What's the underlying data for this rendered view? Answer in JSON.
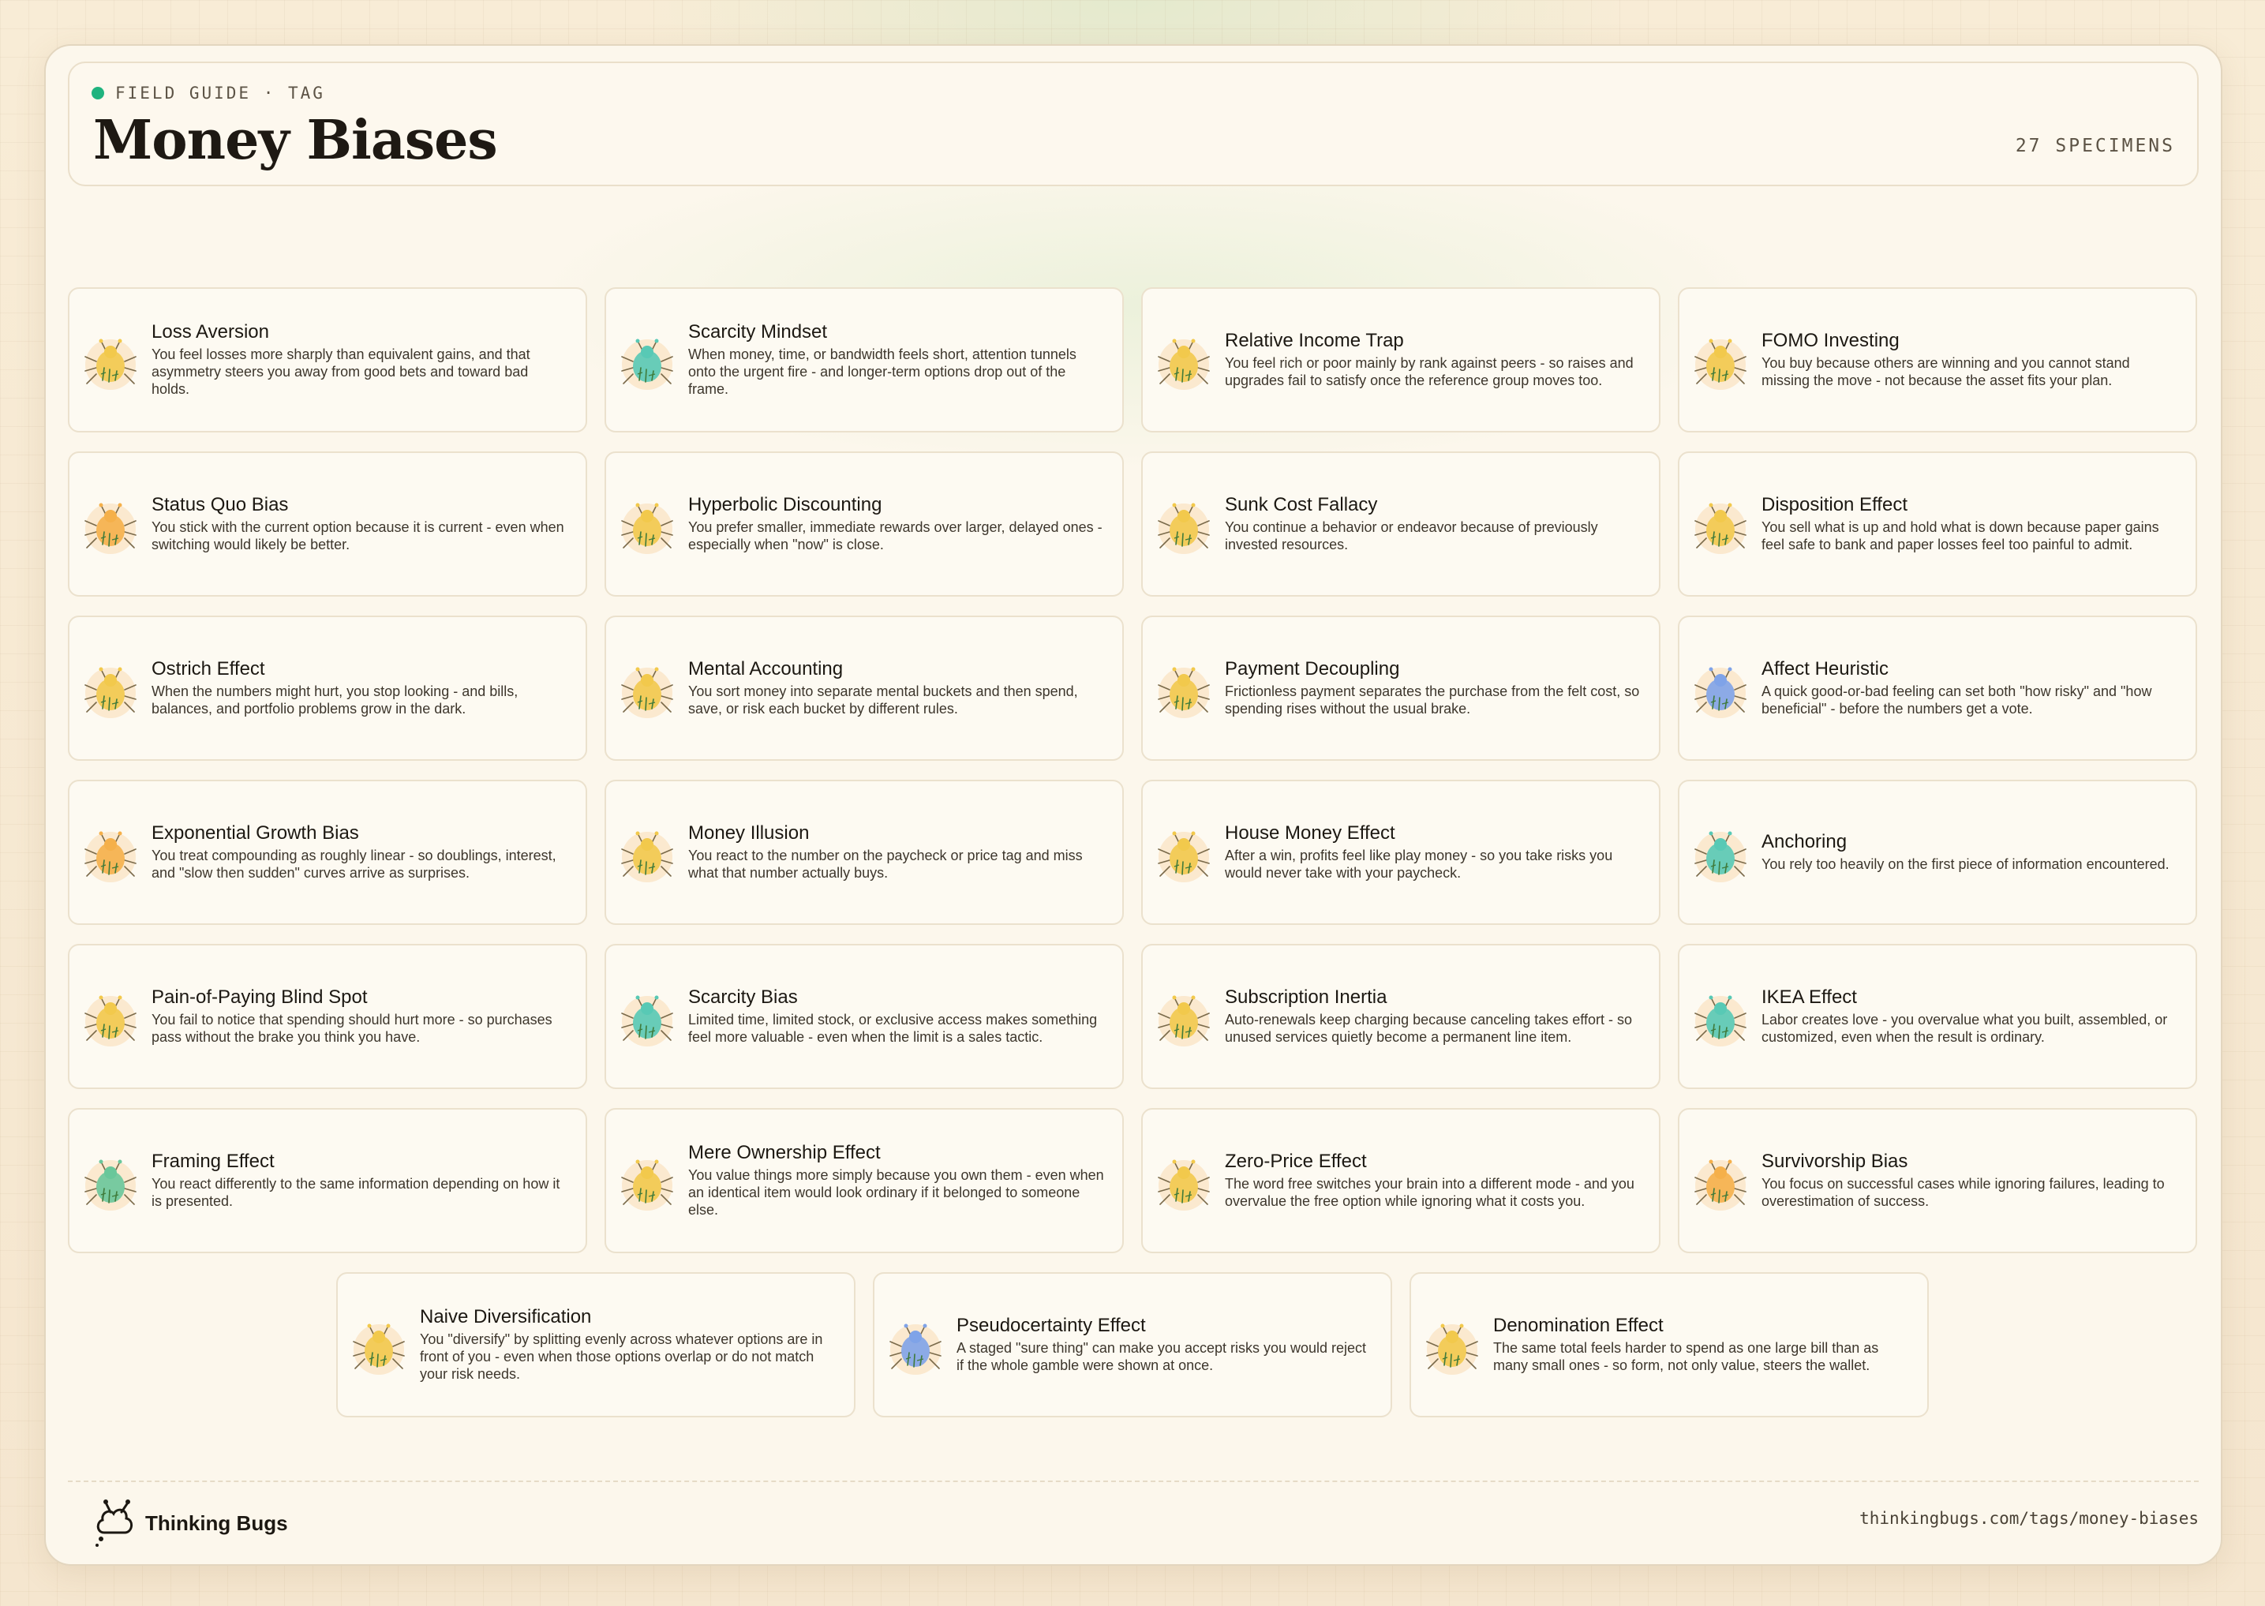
{
  "header": {
    "eyebrow": "FIELD GUIDE · TAG",
    "title": "Money Biases",
    "count": "27 SPECIMENS"
  },
  "colors": {
    "accent_dot": "#1fb37e",
    "bug_yellow": "#f2c94c",
    "bug_teal": "#58c9b5",
    "bug_orange": "#f5b04a",
    "bug_blue": "#7fa3e8",
    "bug_green": "#69c79a"
  },
  "cards": [
    {
      "title": "Loss Aversion",
      "desc": "You feel losses more sharply than equivalent gains, and that asymmetry steers you away from good bets and toward bad holds.",
      "icon": "yellow-bug-icon",
      "color": "#f2c94c"
    },
    {
      "title": "Scarcity Mindset",
      "desc": "When money, time, or bandwidth feels short, attention tunnels onto the urgent fire - and longer-term options drop out of the frame.",
      "icon": "teal-bug-icon",
      "color": "#58c9b5"
    },
    {
      "title": "Relative Income Trap",
      "desc": "You feel rich or poor mainly by rank against peers - so raises and upgrades fail to satisfy once the reference group moves too.",
      "icon": "yellow-bug-icon",
      "color": "#f2c94c"
    },
    {
      "title": "FOMO Investing",
      "desc": "You buy because others are winning and you cannot stand missing the move - not because the asset fits your plan.",
      "icon": "yellow-bug-icon",
      "color": "#f2c94c"
    },
    {
      "title": "Status Quo Bias",
      "desc": "You stick with the current option because it is current - even when switching would likely be better.",
      "icon": "orange-bug-icon",
      "color": "#f5b04a"
    },
    {
      "title": "Hyperbolic Discounting",
      "desc": "You prefer smaller, immediate rewards over larger, delayed ones - especially when \"now\" is close.",
      "icon": "yellow-bug-icon",
      "color": "#f2c94c"
    },
    {
      "title": "Sunk Cost Fallacy",
      "desc": "You continue a behavior or endeavor because of previously invested resources.",
      "icon": "yellow-bug-icon",
      "color": "#f2c94c"
    },
    {
      "title": "Disposition Effect",
      "desc": "You sell what is up and hold what is down because paper gains feel safe to bank and paper losses feel too painful to admit.",
      "icon": "yellow-bug-icon",
      "color": "#f2c94c"
    },
    {
      "title": "Ostrich Effect",
      "desc": "When the numbers might hurt, you stop looking - and bills, balances, and portfolio problems grow in the dark.",
      "icon": "yellow-bug-icon",
      "color": "#f2c94c"
    },
    {
      "title": "Mental Accounting",
      "desc": "You sort money into separate mental buckets and then spend, save, or risk each bucket by different rules.",
      "icon": "yellow-bug-icon",
      "color": "#f2c94c"
    },
    {
      "title": "Payment Decoupling",
      "desc": "Frictionless payment separates the purchase from the felt cost, so spending rises without the usual brake.",
      "icon": "yellow-bug-icon",
      "color": "#f2c94c"
    },
    {
      "title": "Affect Heuristic",
      "desc": "A quick good-or-bad feeling can set both \"how risky\" and \"how beneficial\" - before the numbers get a vote.",
      "icon": "blue-bug-icon",
      "color": "#7fa3e8"
    },
    {
      "title": "Exponential Growth Bias",
      "desc": "You treat compounding as roughly linear - so doublings, interest, and \"slow then sudden\" curves arrive as surprises.",
      "icon": "orange-bug-icon",
      "color": "#f5b04a"
    },
    {
      "title": "Money Illusion",
      "desc": "You react to the number on the paycheck or price tag and miss what that number actually buys.",
      "icon": "yellow-bug-icon",
      "color": "#f2c94c"
    },
    {
      "title": "House Money Effect",
      "desc": "After a win, profits feel like play money - so you take risks you would never take with your paycheck.",
      "icon": "yellow-bug-icon",
      "color": "#f2c94c"
    },
    {
      "title": "Anchoring",
      "desc": "You rely too heavily on the first piece of information encountered.",
      "icon": "teal-bug-icon",
      "color": "#58c9b5"
    },
    {
      "title": "Pain-of-Paying Blind Spot",
      "desc": "You fail to notice that spending should hurt more - so purchases pass without the brake you think you have.",
      "icon": "yellow-bug-icon",
      "color": "#f2c94c"
    },
    {
      "title": "Scarcity Bias",
      "desc": "Limited time, limited stock, or exclusive access makes something feel more valuable - even when the limit is a sales tactic.",
      "icon": "teal-bug-icon",
      "color": "#58c9b5"
    },
    {
      "title": "Subscription Inertia",
      "desc": "Auto-renewals keep charging because canceling takes effort - so unused services quietly become a permanent line item.",
      "icon": "yellow-bug-icon",
      "color": "#f2c94c"
    },
    {
      "title": "IKEA Effect",
      "desc": "Labor creates love - you overvalue what you built, assembled, or customized, even when the result is ordinary.",
      "icon": "teal-bug-icon",
      "color": "#58c9b5"
    },
    {
      "title": "Framing Effect",
      "desc": "You react differently to the same information depending on how it is presented.",
      "icon": "green-bug-icon",
      "color": "#69c79a"
    },
    {
      "title": "Mere Ownership Effect",
      "desc": "You value things more simply because you own them - even when an identical item would look ordinary if it belonged to someone else.",
      "icon": "yellow-bug-icon",
      "color": "#f2c94c"
    },
    {
      "title": "Zero-Price Effect",
      "desc": "The word free switches your brain into a different mode - and you overvalue the free option while ignoring what it costs you.",
      "icon": "yellow-bug-icon",
      "color": "#f2c94c"
    },
    {
      "title": "Survivorship Bias",
      "desc": "You focus on successful cases while ignoring failures, leading to overestimation of success.",
      "icon": "orange-bug-icon",
      "color": "#f5b04a"
    },
    {
      "title": "Naive Diversification",
      "desc": "You \"diversify\" by splitting evenly across whatever options are in front of you - even when those options overlap or do not match your risk needs.",
      "icon": "yellow-bug-icon",
      "color": "#f2c94c"
    },
    {
      "title": "Pseudocertainty Effect",
      "desc": "A staged \"sure thing\" can make you accept risks you would reject if the whole gamble were shown at once.",
      "icon": "blue-bug-icon",
      "color": "#7fa3e8"
    },
    {
      "title": "Denomination Effect",
      "desc": "The same total feels harder to spend as one large bill than as many small ones - so form, not only value, steers the wallet.",
      "icon": "yellow-bug-icon",
      "color": "#f2c94c"
    }
  ],
  "footer": {
    "brand": "Thinking Bugs",
    "url": "thinkingbugs.com/tags/money-biases"
  }
}
